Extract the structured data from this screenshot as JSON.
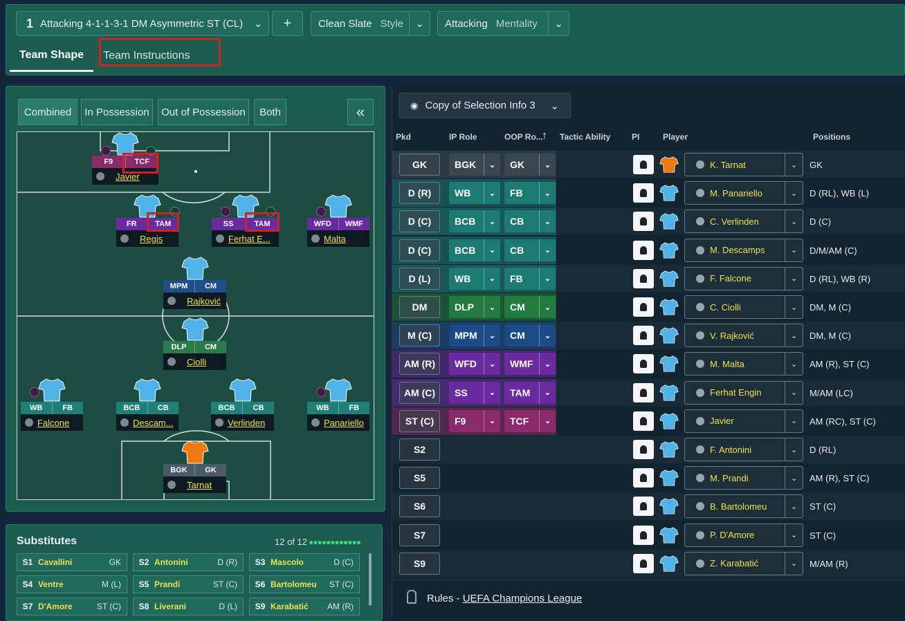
{
  "top": {
    "tactic_number": "1",
    "tactic_name": "Attacking 4-1-1-3-1 DM Asymmetric ST (CL)",
    "add_label": "+",
    "style_value": "Clean Slate",
    "style_label": "Style",
    "mentality_value": "Attacking",
    "mentality_label": "Mentality",
    "tabs": [
      "Team Shape",
      "Team Instructions"
    ]
  },
  "left": {
    "segments": [
      "Combined",
      "In Possession",
      "Out of Possession",
      "Both"
    ],
    "collapse_label": "«",
    "players": [
      {
        "r1": "F9",
        "r2": "TCF",
        "name": "Javier",
        "c1": "#8b2a6a",
        "c2": "#8b2a6a"
      },
      {
        "r1": "FR",
        "r2": "TAM",
        "name": "Regis",
        "c1": "#6a2aa0",
        "c2": "#6a2aa0"
      },
      {
        "r1": "SS",
        "r2": "TAM",
        "name": "Ferhat E...",
        "c1": "#6a2aa0",
        "c2": "#6a2aa0"
      },
      {
        "r1": "WFD",
        "r2": "WMF",
        "name": "Malta",
        "c1": "#6a2aa0",
        "c2": "#6a2aa0"
      },
      {
        "r1": "MPM",
        "r2": "CM",
        "name": "Rajković",
        "c1": "#1f4e8a",
        "c2": "#1f4e8a"
      },
      {
        "r1": "DLP",
        "r2": "CM",
        "name": "Ciolli",
        "c1": "#2a7a4a",
        "c2": "#2a7a4a"
      },
      {
        "r1": "WB",
        "r2": "FB",
        "name": "Falcone",
        "c1": "#1f8078",
        "c2": "#1f8078"
      },
      {
        "r1": "BCB",
        "r2": "CB",
        "name": "Descam...",
        "c1": "#1f8078",
        "c2": "#1f8078"
      },
      {
        "r1": "BCB",
        "r2": "CB",
        "name": "Verlinden",
        "c1": "#1f8078",
        "c2": "#1f8078"
      },
      {
        "r1": "WB",
        "r2": "FB",
        "name": "Panariello",
        "c1": "#1f8078",
        "c2": "#1f8078"
      },
      {
        "r1": "BGK",
        "r2": "GK",
        "name": "Tarnat",
        "c1": "#4a5a66",
        "c2": "#4a5a66"
      }
    ]
  },
  "subs": {
    "title": "Substitutes",
    "count": "12 of 12",
    "items": [
      {
        "no": "S1",
        "name": "Cavallini",
        "pos": "GK"
      },
      {
        "no": "S2",
        "name": "Antonini",
        "pos": "D (R)"
      },
      {
        "no": "S3",
        "name": "Mascolo",
        "pos": "D (C)"
      },
      {
        "no": "S4",
        "name": "Ventre",
        "pos": "M (L)"
      },
      {
        "no": "S5",
        "name": "Prandi",
        "pos": "ST (C)"
      },
      {
        "no": "S6",
        "name": "Bartolomeu",
        "pos": "ST (C)"
      },
      {
        "no": "S7",
        "name": "D'Amore",
        "pos": "ST (C)"
      },
      {
        "no": "S8",
        "name": "Liverani",
        "pos": "D (L)"
      },
      {
        "no": "S9",
        "name": "Karabatić",
        "pos": "AM (R)"
      }
    ]
  },
  "right": {
    "view_label": "Copy of Selection Info 3",
    "headers": {
      "pkd": "Pkd",
      "ip": "IP Role",
      "oop": "OOP Ro...",
      "tactic": "Tactic Ability",
      "pi": "PI",
      "player": "Player",
      "positions": "Positions"
    },
    "rows": [
      {
        "pkd": "GK",
        "ip": "BGK",
        "oop": "GK",
        "player": "K. Tarnat",
        "positions": "GK",
        "color": "#3a4650",
        "gk": true
      },
      {
        "pkd": "D (R)",
        "ip": "WB",
        "oop": "FB",
        "player": "M. Panariello",
        "positions": "D (RL), WB (L)",
        "color": "#1b7a72"
      },
      {
        "pkd": "D (C)",
        "ip": "BCB",
        "oop": "CB",
        "player": "C. Verlinden",
        "positions": "D (C)",
        "color": "#1b7a72"
      },
      {
        "pkd": "D (C)",
        "ip": "BCB",
        "oop": "CB",
        "player": "M. Descamps",
        "positions": "D/M/AM (C)",
        "color": "#1b7a72"
      },
      {
        "pkd": "D (L)",
        "ip": "WB",
        "oop": "FB",
        "player": "F. Falcone",
        "positions": "D (RL), WB (R)",
        "color": "#1b7a72"
      },
      {
        "pkd": "DM",
        "ip": "DLP",
        "oop": "CM",
        "player": "C. Ciolli",
        "positions": "DM, M (C)",
        "color": "#237a3e"
      },
      {
        "pkd": "M (C)",
        "ip": "MPM",
        "oop": "CM",
        "player": "V. Rajković",
        "positions": "DM, M (C)",
        "color": "#1c4a86"
      },
      {
        "pkd": "AM (R)",
        "ip": "WFD",
        "oop": "WMF",
        "player": "M. Malta",
        "positions": "AM (R), ST (C)",
        "color": "#6a2aa0"
      },
      {
        "pkd": "AM (C)",
        "ip": "SS",
        "oop": "TAM",
        "player": "Ferhat Engin",
        "positions": "M/AM (LC)",
        "color": "#6a2aa0"
      },
      {
        "pkd": "ST (C)",
        "ip": "F9",
        "oop": "TCF",
        "player": "Javier",
        "positions": "AM (RC), ST (C)",
        "color": "#8b2a6a"
      },
      {
        "pkd": "S2",
        "player": "F. Antonini",
        "positions": "D (RL)"
      },
      {
        "pkd": "S5",
        "player": "M. Prandi",
        "positions": "AM (R), ST (C)"
      },
      {
        "pkd": "S6",
        "player": "B. Bartolomeu",
        "positions": "ST (C)"
      },
      {
        "pkd": "S7",
        "player": "P. D'Amore",
        "positions": "ST (C)"
      },
      {
        "pkd": "S9",
        "player": "Z. Karabatić",
        "positions": "M/AM (R)"
      }
    ],
    "rules_prefix": "Rules - ",
    "rules_link": "UEFA Champions League"
  }
}
